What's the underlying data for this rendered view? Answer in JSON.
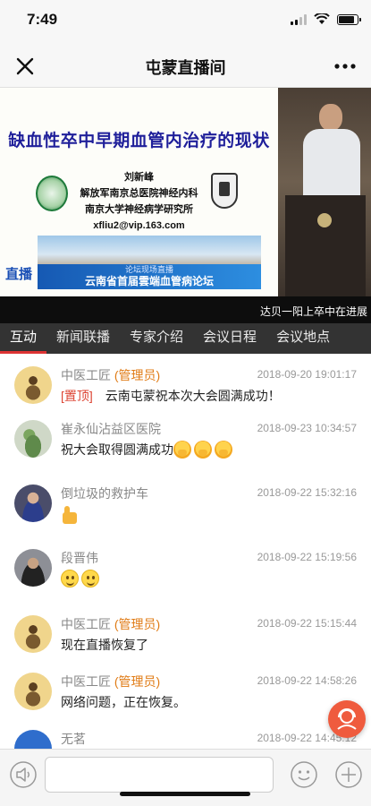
{
  "status": {
    "time": "7:49",
    "battery_level": 0.85
  },
  "nav": {
    "title": "屯蒙直播间",
    "close_icon": "close-icon",
    "more_icon": "more-icon"
  },
  "video": {
    "slide_title": "缺血性卒中早期血管内治疗的现状",
    "author_name": "刘新峰",
    "author_affiliation_1": "解放军南京总医院神经内科",
    "author_affiliation_2": "南京大学神经病学研究所",
    "author_email": "xfliu2@vip.163.com",
    "live_label": "直播",
    "banner_sub": "论坛现场直播",
    "banner_main": "云南省首届雲端血管病论坛",
    "ticker": "达贝一阳上卒中在进展"
  },
  "tabs": [
    {
      "label": "互动",
      "active": true
    },
    {
      "label": "新闻联播"
    },
    {
      "label": "专家介绍"
    },
    {
      "label": "会议日程"
    },
    {
      "label": "会议地点"
    }
  ],
  "messages": [
    {
      "avatar": "scholar-avatar",
      "name": "中医工匠",
      "role": "(管理员)",
      "time": "2018-09-20 19:01:17",
      "pin": "[置顶]",
      "text": "云南屯蒙祝本次大会圆满成功！",
      "emoji": []
    },
    {
      "avatar": "plant-avatar",
      "name": "崔永仙沾益区医院",
      "role": "",
      "time": "2018-09-23 10:34:57",
      "pin": "",
      "text": "祝大会取得圆满成功",
      "emoji": [
        "folded-hands-emoji",
        "folded-hands-emoji",
        "folded-hands-emoji"
      ]
    },
    {
      "avatar": "woman-avatar",
      "name": "倒垃圾的救护车",
      "role": "",
      "time": "2018-09-22 15:32:16",
      "pin": "",
      "text": "",
      "emoji": [
        "thumbs-up-emoji"
      ]
    },
    {
      "avatar": "man-avatar",
      "name": "段晋伟",
      "role": "",
      "time": "2018-09-22 15:19:56",
      "pin": "",
      "text": "",
      "emoji": [
        "smile-emoji",
        "smile-emoji"
      ]
    },
    {
      "avatar": "scholar-avatar",
      "name": "中医工匠",
      "role": "(管理员)",
      "time": "2018-09-22 15:15:44",
      "pin": "",
      "text": "现在直播恢复了",
      "emoji": []
    },
    {
      "avatar": "scholar-avatar",
      "name": "中医工匠",
      "role": "(管理员)",
      "time": "2018-09-22 14:58:26",
      "pin": "",
      "text": "网络问题，正在恢复。",
      "emoji": []
    },
    {
      "avatar": "sky-avatar",
      "name": "无茗",
      "role": "",
      "time": "2018-09-22 14:45:12",
      "pin": "",
      "text": "",
      "emoji": []
    }
  ],
  "input_bar": {
    "voice_icon": "speaker-icon",
    "emoji_icon": "emoji-icon",
    "plus_icon": "plus-icon",
    "input_value": ""
  },
  "float_button": {
    "icon": "customer-service-icon",
    "color": "#ef5b3e"
  },
  "colors": {
    "admin_role": "#e07b15",
    "pin": "#d43",
    "tab_bar": "#333333",
    "tab_active_underline": "#dd3333"
  }
}
